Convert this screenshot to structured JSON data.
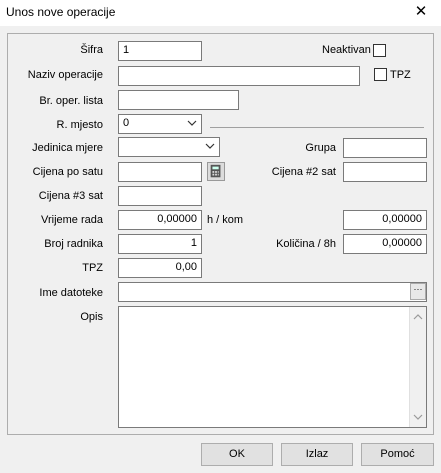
{
  "window": {
    "title": "Unos nove operacije"
  },
  "labels": {
    "sifra": "Šifra",
    "neaktivan": "Neaktivan",
    "naziv": "Naziv operacije",
    "tpz_check": "TPZ",
    "br_oper_lista": "Br. oper. lista",
    "r_mjesto": "R. mjesto",
    "jedinica_mjere": "Jedinica mjere",
    "grupa": "Grupa",
    "cijena_po_satu": "Cijena po satu",
    "cijena2": "Cijena #2 sat",
    "cijena3": "Cijena #3 sat",
    "vrijeme_rada": "Vrijeme rada",
    "unit_kom": "h / kom",
    "broj_radnika": "Broj radnika",
    "kolicina_8h": "Količina / 8h",
    "tpz": "TPZ",
    "ime_datoteke": "Ime datoteke",
    "opis": "Opis"
  },
  "values": {
    "sifra": "1",
    "r_mjesto": "0",
    "vrijeme_rada": "0,00000",
    "vrijeme_rada_right": "0,00000",
    "broj_radnika": "1",
    "kolicina_8h": "0,00000",
    "tpz": "0,00",
    "ellipsis": "···"
  },
  "buttons": {
    "ok": "OK",
    "izlaz": "Izlaz",
    "pomoc": "Pomoć"
  }
}
